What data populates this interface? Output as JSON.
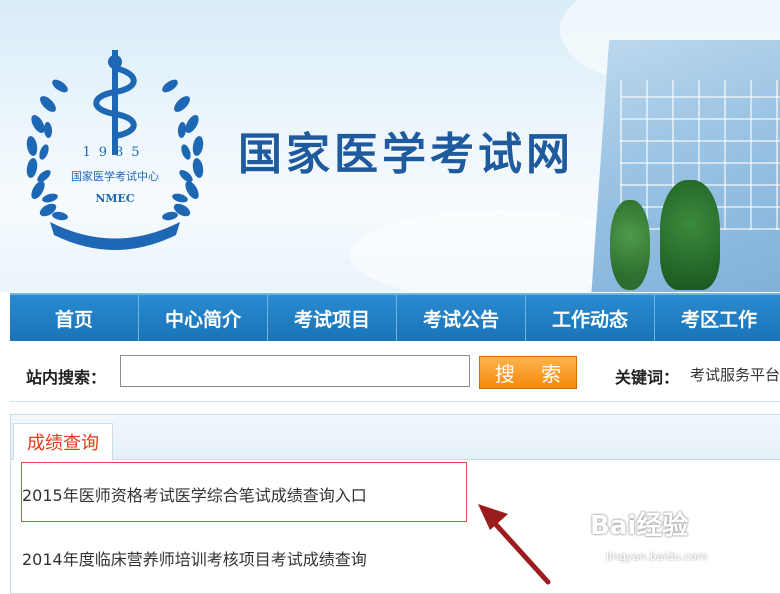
{
  "banner": {
    "site_title": "国家医学考试网",
    "logo": {
      "year": "1985",
      "center_name": "国家医学考试中心",
      "abbr": "NMEC"
    }
  },
  "nav": {
    "items": [
      {
        "label": "首页"
      },
      {
        "label": "中心简介"
      },
      {
        "label": "考试项目"
      },
      {
        "label": "考试公告"
      },
      {
        "label": "工作动态"
      },
      {
        "label": "考区工作"
      }
    ]
  },
  "search": {
    "label": "站内搜索：",
    "input_value": "",
    "button_label": "搜 索",
    "keyword_label": "关键词：",
    "keyword_text": "考试服务平台"
  },
  "content": {
    "tab_label": "成绩查询",
    "results": [
      {
        "text": "2015年医师资格考试医学综合笔试成绩查询入口",
        "highlighted": true
      },
      {
        "text": "2014年度临床营养师培训考核项目考试成绩查询",
        "highlighted": false
      }
    ]
  },
  "watermark": {
    "brand": "Bai经验",
    "url": "jingyan.baidu.com"
  },
  "colors": {
    "nav_blue": "#1f7fc4",
    "title_blue": "#1d5a9e",
    "search_orange": "#f58a0b",
    "tab_red": "#e13a1a",
    "highlight_red": "#e04a4a",
    "arrow_red": "#9b1c1c"
  }
}
